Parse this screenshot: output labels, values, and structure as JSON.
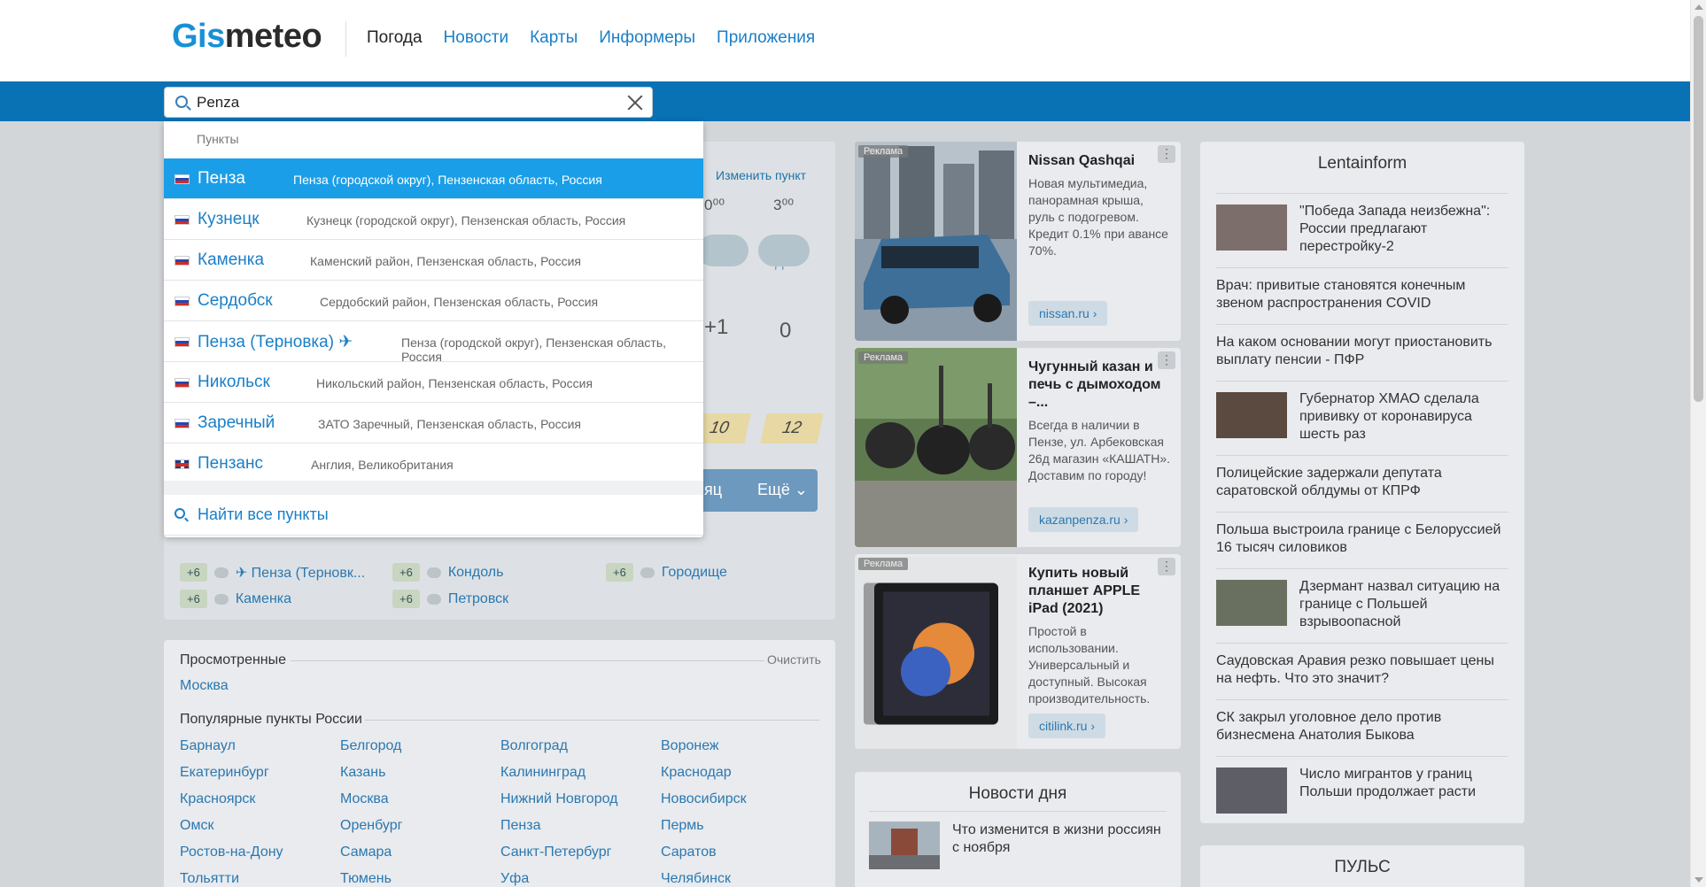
{
  "header": {
    "logo_gis": "Gis",
    "logo_meteo": "meteo",
    "nav": [
      "Погода",
      "Новости",
      "Карты",
      "Информеры",
      "Приложения"
    ]
  },
  "search": {
    "value": "Penza"
  },
  "dropdown": {
    "section_label": "Пункты",
    "items": [
      {
        "name": "Пенза",
        "desc": "Пенза (городской округ), Пензенская область, Россия",
        "flag": "ru",
        "selected": true
      },
      {
        "name": "Кузнецк",
        "desc": "Кузнецк (городской округ), Пензенская область, Россия",
        "flag": "ru"
      },
      {
        "name": "Каменка",
        "desc": "Каменский район, Пензенская область, Россия",
        "flag": "ru"
      },
      {
        "name": "Сердобск",
        "desc": "Сердобский район, Пензенская область, Россия",
        "flag": "ru"
      },
      {
        "name": "Пенза (Терновка) ✈",
        "desc": "Пенза (городской округ), Пензенская область, Россия",
        "flag": "ru"
      },
      {
        "name": "Никольск",
        "desc": "Никольский район, Пензенская область, Россия",
        "flag": "ru"
      },
      {
        "name": "Заречный",
        "desc": "ЗАТО Заречный, Пензенская область, Россия",
        "flag": "ru"
      },
      {
        "name": "Пензанс",
        "desc": "Англия, Великобритания",
        "flag": "gb"
      }
    ],
    "find_all": "Найти все пункты"
  },
  "weather": {
    "change_point": "Изменить пункт",
    "times": [
      "0⁰⁰",
      "3⁰⁰"
    ],
    "temps": [
      "+1",
      "0"
    ],
    "wind": [
      "10",
      "12"
    ],
    "bar_left": "яц",
    "bar_more": "Ещё ⌄"
  },
  "nearby": [
    {
      "badge": "+6",
      "name": "✈ Пенза (Терновк..."
    },
    {
      "badge": "+6",
      "name": "Кондоль"
    },
    {
      "badge": "+6",
      "name": "Городище"
    },
    {
      "badge": "+6",
      "name": "Каменка"
    },
    {
      "badge": "+6",
      "name": "Петровск"
    }
  ],
  "viewed": {
    "title": "Просмотренные",
    "clear": "Очистить",
    "items": [
      "Москва"
    ]
  },
  "popular": {
    "title": "Популярные пункты России",
    "items": [
      "Барнаул",
      "Белгород",
      "Волгоград",
      "Воронеж",
      "Екатеринбург",
      "Казань",
      "Калининград",
      "Краснодар",
      "Красноярск",
      "Москва",
      "Нижний Новгород",
      "Новосибирск",
      "Омск",
      "Оренбург",
      "Пенза",
      "Пермь",
      "Ростов-на-Дону",
      "Самара",
      "Санкт-Петербург",
      "Саратов",
      "Тольятти",
      "Тюмень",
      "Уфа",
      "Челябинск"
    ]
  },
  "ads": [
    {
      "label": "Реклама",
      "title": "Nissan Qashqai",
      "text": "Новая мультимедиа, панорамная крыша, руль с подогревом. Кредит 0.1% при авансе 70%.",
      "link": "nissan.ru ›"
    },
    {
      "label": "Реклама",
      "title": "Чугунный казан и печь с дымоходом –...",
      "text": "Всегда в наличии в Пензе, ул. Арбековская 26д магазин «КАШАТН». Доставим по городу!",
      "link": "kazanpenza.ru ›"
    },
    {
      "label": "Реклама",
      "title": "Купить новый планшет APPLE iPad (2021)",
      "text": "Простой в использовании. Универсальный и доступный. Высокая производительность.",
      "link": "citilink.ru ›"
    }
  ],
  "news_day": {
    "title": "Новости дня",
    "item": "Что изменится в жизни россиян с ноября"
  },
  "lenta": {
    "title": "Lentainform",
    "items": [
      {
        "text": "\"Победа Запада неизбежна\": России предлагают перестройку-2",
        "thumb": true
      },
      {
        "text": "Врач: привитые становятся конечным звеном распространения COVID",
        "thumb": false
      },
      {
        "text": "На каком основании могут приостановить выплату пенсии - ПФР",
        "thumb": false
      },
      {
        "text": "Губернатор ХМАО сделала прививку от коронавируса шесть раз",
        "thumb": true
      },
      {
        "text": "Полицейские задержали депутата саратовской облдумы от КПРФ",
        "thumb": false
      },
      {
        "text": "Польша выстроила границе с Белоруссией 16 тысяч силовиков",
        "thumb": false
      },
      {
        "text": "Дзермант назвал ситуацию на границе с Польшей взрывоопасной",
        "thumb": true
      },
      {
        "text": "Саудовская Аравия резко повышает цены на нефть. Что это значит?",
        "thumb": false
      },
      {
        "text": "СК закрыл уголовное дело против бизнесмена Анатолия Быкова",
        "thumb": false
      },
      {
        "text": "Число мигрантов у границ Польши продолжает расти",
        "thumb": true
      }
    ]
  },
  "pulse": {
    "title": "ПУЛЬС"
  }
}
